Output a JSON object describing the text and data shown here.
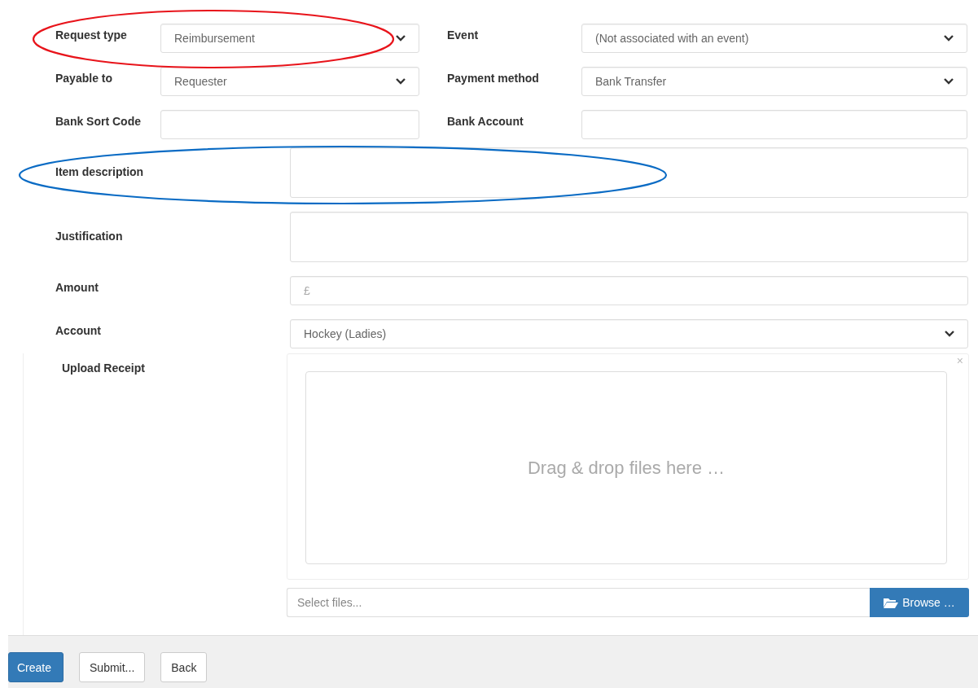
{
  "top_fields": [
    {
      "label": "Request type",
      "kind": "select",
      "value": "Reimbursement"
    },
    {
      "label": "Event",
      "kind": "select",
      "value": "(Not associated with an event)"
    },
    {
      "label": "Payable to",
      "kind": "select",
      "value": "Requester"
    },
    {
      "label": "Payment method",
      "kind": "select",
      "value": "Bank Transfer"
    },
    {
      "label": "Bank Sort Code",
      "kind": "text"
    },
    {
      "label": "Bank Account",
      "kind": "text"
    }
  ],
  "wide_fields": [
    {
      "label": "Item description",
      "kind": "textarea"
    },
    {
      "label": "Justification",
      "kind": "textarea"
    },
    {
      "label": "Amount",
      "kind": "text",
      "placeholder": "£"
    },
    {
      "label": "Account",
      "kind": "select",
      "value": "Hockey (Ladies)"
    }
  ],
  "upload": {
    "label": "Upload Receipt",
    "close": "×",
    "drop_hint": "Drag & drop files here …",
    "file_placeholder": "Select files...",
    "browse": "Browse …"
  },
  "buttons": [
    {
      "label": "Create",
      "kind": "primary"
    },
    {
      "label": "Submit...",
      "kind": "default"
    },
    {
      "label": "Back",
      "kind": "default"
    }
  ],
  "annotations": [
    {
      "color": "#e8141b"
    },
    {
      "color": "#0a6bc4"
    }
  ]
}
